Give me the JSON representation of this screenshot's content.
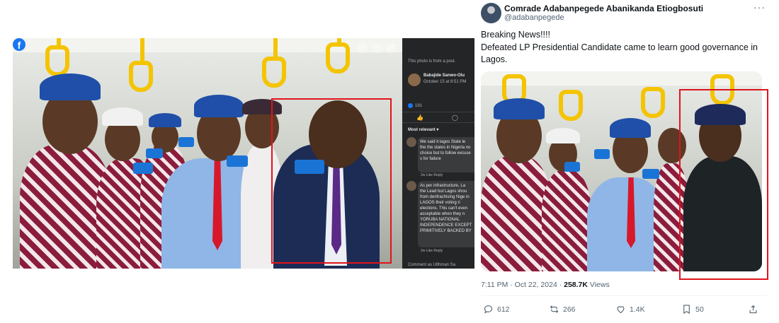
{
  "facebook": {
    "logo": "f",
    "note": "This photo is from a post.",
    "poster_name": "Babajide Sanwo-Olu",
    "post_date": "October 15 at 8:51 PM",
    "likes_count": "191",
    "sort_label": "Most relevant",
    "comments": [
      {
        "text": "We said it lagos State le the the states in Nigeria no choice but to follow excuse s for failure",
        "meta": "2w  Like  Reply"
      },
      {
        "text": "As per infrastructure, La the Lead but Lagos shou from denfrachising Nige in LAGOS their voting ri elections. This can't even acceptable when they n YORUBA NATIONAL INDEPENDENCE EXCEPT PRIMITIVELY BACKED BY",
        "meta": "2w  Like  Reply"
      }
    ],
    "compose_placeholder": "Comment as Ulthman Sa",
    "icons": [
      "zoom-in-icon",
      "zoom-out-icon",
      "expand-icon"
    ]
  },
  "tweet": {
    "display_name": "Comrade Adabanpegede Abanikanda Etiogbosuti",
    "handle": "@adabanpegede",
    "more": "···",
    "text_line1": "Breaking News!!!!",
    "text_line2": "Defeated LP Presidential Candidate came to learn good governance in Lagos.",
    "time": "7:11 PM · Oct 22, 2024 · ",
    "views_count": "258.7K",
    "views_label": " Views",
    "replies": "612",
    "reposts": "266",
    "likes": "1.4K",
    "bookmarks": "50"
  },
  "colors": {
    "annotation_red": "#e0141b",
    "facebook_blue": "#1877f2",
    "handle_yellow": "#f4c400"
  }
}
